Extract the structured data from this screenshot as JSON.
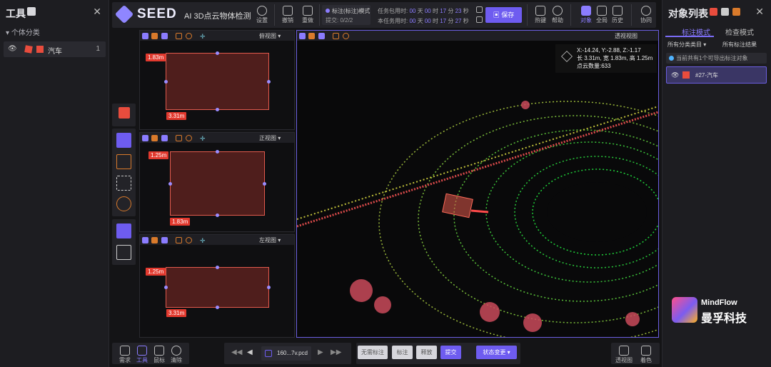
{
  "left_panel": {
    "title": "工具",
    "category_label": "个体分类",
    "item_label": "汽车",
    "item_count": "1"
  },
  "toolbar": {
    "brand": "SEED",
    "subtitle": "AI 3D点云物体检测",
    "settings": "设置",
    "undo": "撤销",
    "redo": "重做",
    "mode_label": "标注(标注)模式",
    "submit_progress": "提交: 0/2/2",
    "task_timer_label": "任务包用时:",
    "task_timer": [
      "00",
      "天",
      "00",
      "时",
      "17",
      "分",
      "23",
      "秒"
    ],
    "subtask_timer_label": "本任务用时:",
    "subtask_timer": [
      "00",
      "天",
      "00",
      "时",
      "17",
      "分",
      "27",
      "秒"
    ],
    "save": "保存",
    "hotkey": "热键",
    "help": "帮助",
    "object": "对象",
    "fullscreen": "全局",
    "history": "历史",
    "collab": "协同"
  },
  "views": {
    "top_name": "俯视图",
    "front_name": "正视图",
    "side_name": "左视图",
    "persp_name": "透视视图",
    "top_dims": [
      "1.83m",
      "3.31m"
    ],
    "front_dims": [
      "1.25m",
      "1.83m"
    ],
    "side_dims": [
      "1.25m",
      "3.31m"
    ]
  },
  "info_box": {
    "coords": "X:-14.24,  Y:-2.88,  Z:-1.17",
    "size": "长 3.31m, 宽 1.83m, 高 1.25m",
    "points": "点云数量:633"
  },
  "right_panel": {
    "title": "对象列表",
    "tab1": "标注模式",
    "tab2": "检查模式",
    "filter1": "所有分类类目",
    "filter2": "所有标注结果",
    "notice": "当前共有1个可导出标注对象",
    "object_label": "#27-汽车"
  },
  "bottom": {
    "left_tools": [
      "需求",
      "工具",
      "鼠标",
      "清除"
    ],
    "file": "160...7v.pcd",
    "no_annotation": "无需标注",
    "annotate": "标注",
    "release": "释放",
    "submit": "提交",
    "state_change": "状态变更",
    "perspective": "透视图",
    "color": "着色"
  },
  "watermark": {
    "en": "MindFlow",
    "cn": "曼孚科技"
  }
}
